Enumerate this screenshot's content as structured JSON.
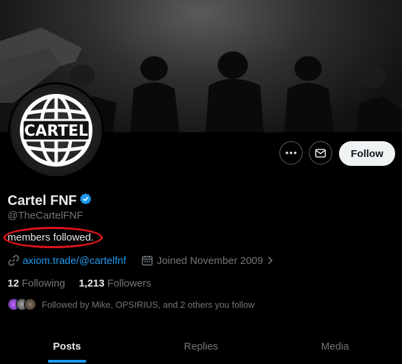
{
  "profile": {
    "name": "Cartel FNF",
    "handle": "@TheCartelFNF",
    "bio": "members followed.",
    "avatar_text": "CARTEL",
    "link": "axiom.trade/@cartelfnf",
    "joined": "Joined November 2009",
    "following_count": "12",
    "following_label": "Following",
    "followers_count": "1,213",
    "followers_label": "Followers",
    "followed_by": "Followed by Mike, OPSIRIUS, and 2 others you follow"
  },
  "actions": {
    "more_icon": "more-icon",
    "message_icon": "envelope-icon",
    "follow_label": "Follow"
  },
  "tabs": [
    {
      "label": "Posts",
      "active": true
    },
    {
      "label": "Replies",
      "active": false
    },
    {
      "label": "Media",
      "active": false
    }
  ],
  "colors": {
    "accent": "#1d9bf0",
    "annotation": "#e0151b",
    "muted": "#71767b"
  }
}
